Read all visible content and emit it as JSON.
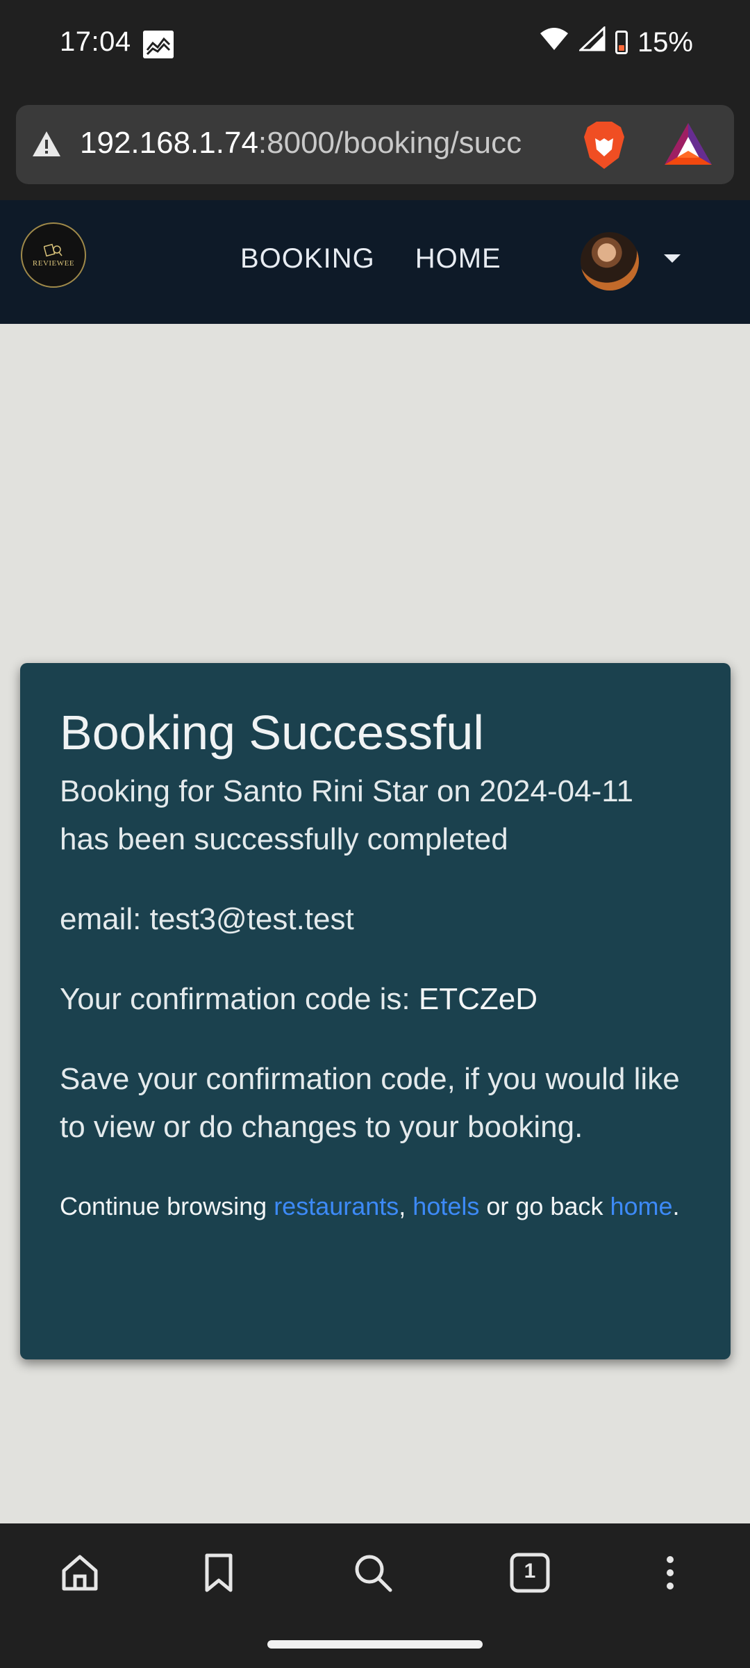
{
  "status_bar": {
    "time": "17:04",
    "battery": "15%",
    "icons": [
      "gallery-icon",
      "wifi-icon",
      "signal-icon",
      "battery-icon"
    ]
  },
  "browser": {
    "url_host": "192.168.1.74",
    "url_rest": ":8000/booking/succ",
    "icons": [
      "warning-icon",
      "brave-lion-icon",
      "bat-rewards-icon"
    ]
  },
  "navbar": {
    "logo_text": "REVIEWEE",
    "links": [
      {
        "label": "BOOKING"
      },
      {
        "label": "HOME"
      }
    ]
  },
  "card": {
    "title": "Booking Successful",
    "booking_line": "Booking for Santo Rini Star on 2024-04-11 has been successfully completed",
    "email_line": "email: test3@test.test",
    "code_prefix": "Your confirmation code is: ",
    "code": "ETCZeD",
    "save_note": "Save your confirmation code, if you would like to view or do changes to your booking.",
    "continue_prefix": "Continue browsing ",
    "link_restaurants": "restaurants",
    "separator": ", ",
    "link_hotels": "hotels",
    "continue_middle": " or go back ",
    "link_home": "home",
    "continue_suffix": "."
  },
  "toolbar": {
    "tab_count": "1",
    "icons": [
      "home-icon",
      "bookmark-icon",
      "search-icon",
      "tabs-icon",
      "more-icon"
    ]
  },
  "colors": {
    "page_bg": "#e1e1dd",
    "navbar_bg": "#0e1a28",
    "card_bg": "#1b414e",
    "link": "#3d8af7",
    "system_bar": "#202020"
  }
}
